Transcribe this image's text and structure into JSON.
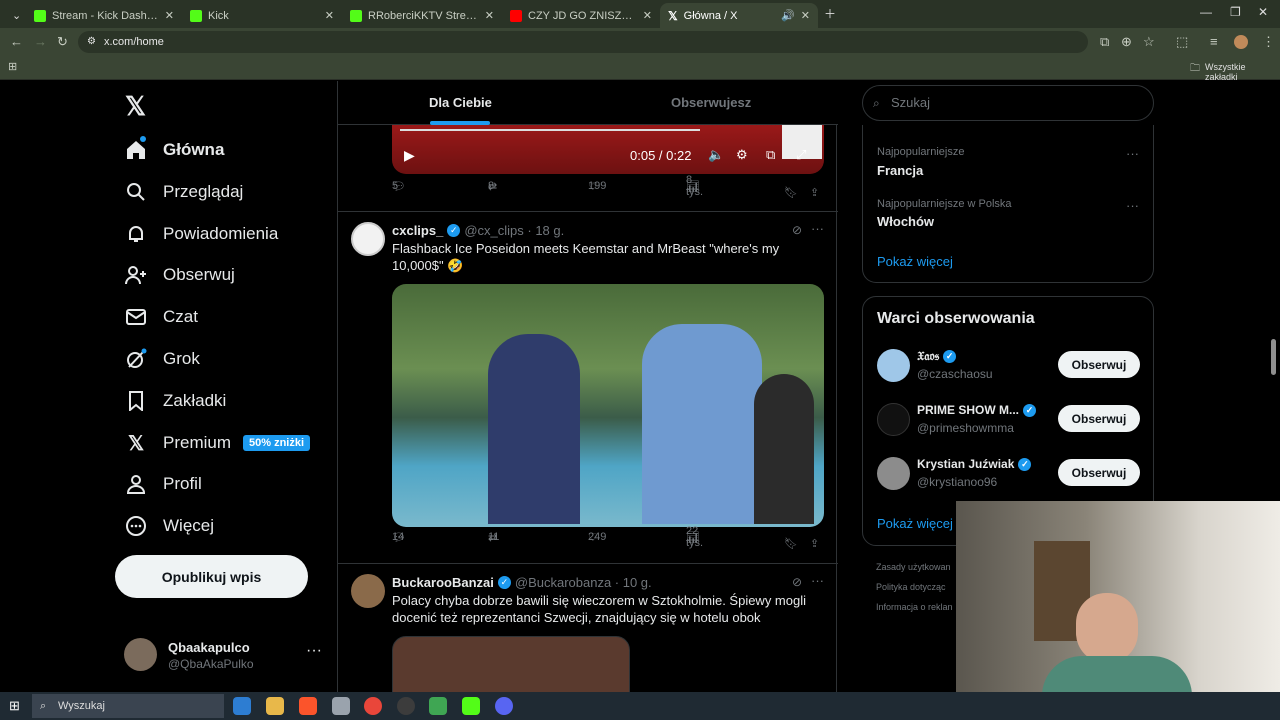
{
  "browser": {
    "tabs": [
      {
        "title": "Stream - Kick Dashboard",
        "color": "#53fc18"
      },
      {
        "title": "Kick",
        "color": "#53fc18"
      },
      {
        "title": "RRoberciKKTV Stream - Watch Liv",
        "color": "#53fc18"
      },
      {
        "title": "CZY JD GO ZNISZCZYŁO? - Dis",
        "color": "#ff0000"
      },
      {
        "title": "Główna / X",
        "color": "#ffffff"
      }
    ],
    "url": "x.com/home",
    "bookmarks_label": "Wszystkie zakładki"
  },
  "sidebar": {
    "items": [
      {
        "label": "Główna",
        "icon": "home-icon"
      },
      {
        "label": "Przeglądaj",
        "icon": "search-icon"
      },
      {
        "label": "Powiadomienia",
        "icon": "bell-icon"
      },
      {
        "label": "Obserwuj",
        "icon": "follow-icon"
      },
      {
        "label": "Czat",
        "icon": "mail-icon"
      },
      {
        "label": "Grok",
        "icon": "grok-icon"
      },
      {
        "label": "Zakładki",
        "icon": "bookmark-icon"
      },
      {
        "label": "Premium",
        "icon": "x-icon"
      },
      {
        "label": "Profil",
        "icon": "person-icon"
      },
      {
        "label": "Więcej",
        "icon": "more-circle-icon"
      }
    ],
    "premium_badge": "50% zniżki",
    "post_button": "Opublikuj wpis",
    "profile": {
      "name": "Qbaakapulco",
      "handle": "@QbaAkaPulko"
    }
  },
  "feed": {
    "tabs": [
      "Dla Ciebie",
      "Obserwujesz"
    ],
    "video_time": "0:05 / 0:22",
    "tweet0_actions": {
      "replies": "5",
      "reposts": "8",
      "likes": "199",
      "views": "8 tys."
    },
    "tweets": [
      {
        "name": "cxclips_",
        "handle": "@cx_clips · 18 g.",
        "text": "Flashback Ice Poseidon meets Keemstar and MrBeast \"where's my 10,000$\" 🤣",
        "replies": "14",
        "reposts": "11",
        "likes": "249",
        "views": "22 tys."
      },
      {
        "name": "BuckarooBanzai",
        "handle": "@Buckarobanza · 10 g.",
        "text": "Polacy chyba dobrze bawili się wieczorem w Sztokholmie. Śpiewy mogli docenić też reprezentanci Szwecji, znajdujący się w hotelu obok"
      }
    ]
  },
  "right": {
    "search_placeholder": "Szukaj",
    "trends": [
      {
        "sub": "Najpopularniejsze",
        "name": "Francja"
      },
      {
        "sub": "Najpopularniejsze w Polska",
        "name": "Włochów"
      }
    ],
    "show_more": "Pokaż więcej",
    "wtf_title": "Warci obserwowania",
    "wtf": [
      {
        "name": "𝔛𝔞𝔬𝔰",
        "handle": "@czaschaosu"
      },
      {
        "name": "PRIME SHOW M...",
        "handle": "@primeshowmma"
      },
      {
        "name": "Krystian Juźwiak",
        "handle": "@krystianoo96"
      }
    ],
    "follow_label": "Obserwuj",
    "footer": [
      "Zasady użytkowan",
      "Polityka dotycząc",
      "Informacja o reklan"
    ]
  },
  "taskbar": {
    "search": "Wyszukaj"
  }
}
